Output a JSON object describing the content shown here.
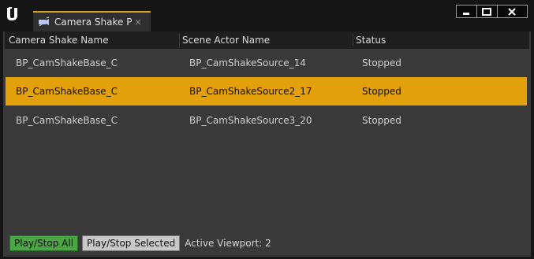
{
  "window": {
    "tab_title": "Camera Shake Pre",
    "tab_close_glyph": "×",
    "logo_icon": "unreal-logo-icon",
    "controls": {
      "minimize_icon": "minimize-icon",
      "maximize_icon": "maximize-icon",
      "close_icon": "close-icon"
    }
  },
  "table": {
    "columns": [
      "Camera Shake Name",
      "Scene Actor Name",
      "Status"
    ],
    "rows": [
      {
        "shake": "BP_CamShakeBase_C",
        "actor": "BP_CamShakeSource_14",
        "status": "Stopped",
        "selected": false
      },
      {
        "shake": "BP_CamShakeBase_C",
        "actor": "BP_CamShakeSource2_17",
        "status": "Stopped",
        "selected": true
      },
      {
        "shake": "BP_CamShakeBase_C",
        "actor": "BP_CamShakeSource3_20",
        "status": "Stopped",
        "selected": false
      }
    ]
  },
  "footer": {
    "play_stop_all": "Play/Stop All",
    "play_stop_selected": "Play/Stop Selected",
    "active_viewport": "Active Viewport: 2"
  },
  "colors": {
    "accent": "#e2a10a",
    "play_all_button": "#4aa642",
    "panel": "#3a3a3a",
    "header": "#1f1f1f"
  }
}
